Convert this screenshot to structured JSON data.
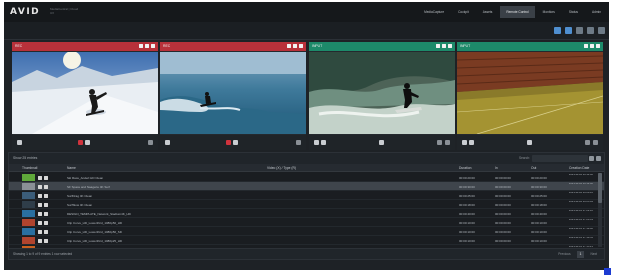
{
  "app": {
    "logo": "AVID",
    "logo_sub": "MediaCentral | Cloud UX"
  },
  "nav": {
    "tabs": [
      {
        "label": "MediaCapture",
        "active": false
      },
      {
        "label": "Cockpit",
        "active": false
      },
      {
        "label": "Assets",
        "active": false
      },
      {
        "label": "Remote Control",
        "active": true
      },
      {
        "label": "Monitors",
        "active": false
      },
      {
        "label": "Status",
        "active": false
      },
      {
        "label": "Admin",
        "active": false
      }
    ]
  },
  "monitors": [
    {
      "title": "REC",
      "color": "red",
      "scene": "ski"
    },
    {
      "title": "REC",
      "color": "red",
      "scene": "surf"
    },
    {
      "title": "INPUT",
      "color": "green",
      "scene": "wave"
    },
    {
      "title": "INPUT",
      "color": "green",
      "scene": "stadium"
    }
  ],
  "browser": {
    "label": "Show 25 entries",
    "filter_label": "Search:",
    "columns": {
      "thumbnail": "Thumbnail",
      "name": "Name",
      "video": "Video (X) / Type (R)",
      "duration": "Duration",
      "in": "In",
      "out": "Out",
      "creation": "Creation Date"
    },
    "rows": [
      {
        "name": "Ski Race_Anderl HD Clean",
        "duration": "00:00:20:00",
        "in": "00:00:00:00",
        "out": "00:00:20:00",
        "date": "2021-11-26 10:14:00",
        "thumb": "#5fa83a",
        "selected": false
      },
      {
        "name": "SF Space and Naagerie 4K Surf",
        "duration": "00:00:30:00",
        "in": "00:00:00:00",
        "out": "00:00:30:00",
        "date": "2021-11-26 10:12:40",
        "thumb": "#8a9096",
        "selected": true
      },
      {
        "name": "SurfDrag 4K Clean",
        "duration": "00:00:25:00",
        "in": "00:00:00:00",
        "out": "00:00:25:00",
        "date": "2021-11-26 10:08:12",
        "thumb": "#3b5d7a",
        "selected": false
      },
      {
        "name": "SurfSlow 4K Clean",
        "duration": "00:00:18:00",
        "in": "00:00:00:00",
        "out": "00:00:18:00",
        "date": "2021-11-26 10:05:44",
        "thumb": "#2f3d49",
        "selected": false
      },
      {
        "name": "DESIGN_TEMPLATE_Network_Stadium4K_HD",
        "duration": "00:00:40:00",
        "in": "00:00:00:00",
        "out": "00:00:40:00",
        "date": "2021-11-25 17:22:10",
        "thumb": "#2a6fa0",
        "selected": false
      },
      {
        "name": "Clip Curve_HD_Lowerthird_1080p50_HD",
        "duration": "00:00:10:00",
        "in": "00:00:00:00",
        "out": "00:00:10:00",
        "date": "2021-11-25 17:20:03",
        "thumb": "#b0442e",
        "selected": false
      },
      {
        "name": "Clip Curve_HD_Lowerthird_1080p50_SD",
        "duration": "00:00:10:00",
        "in": "00:00:00:00",
        "out": "00:00:10:00",
        "date": "2021-11-25 17:19:40",
        "thumb": "#2a6fa0",
        "selected": false
      },
      {
        "name": "Clip Curve_HD_Lowerthird_1080p25_HD",
        "duration": "00:00:10:00",
        "in": "00:00:00:00",
        "out": "00:00:10:00",
        "date": "2021-11-25 17:18:55",
        "thumb": "#b0442e",
        "selected": false
      },
      {
        "name": "Clip_1_Fireside",
        "duration": "00:00:12:00",
        "in": "00:00:00:00",
        "out": "00:00:12:00",
        "date": "2021-11-25 17:15:21",
        "thumb": "#c9601f",
        "selected": false
      }
    ],
    "status": "Showing 1 to 9 of 9 entries   1 row selected",
    "pager": {
      "prev": "Previous",
      "page": "1",
      "next": "Next"
    }
  },
  "colors": {
    "rec": "#b8313a",
    "input": "#1d8a6a",
    "accent": "#4f8fd0"
  }
}
